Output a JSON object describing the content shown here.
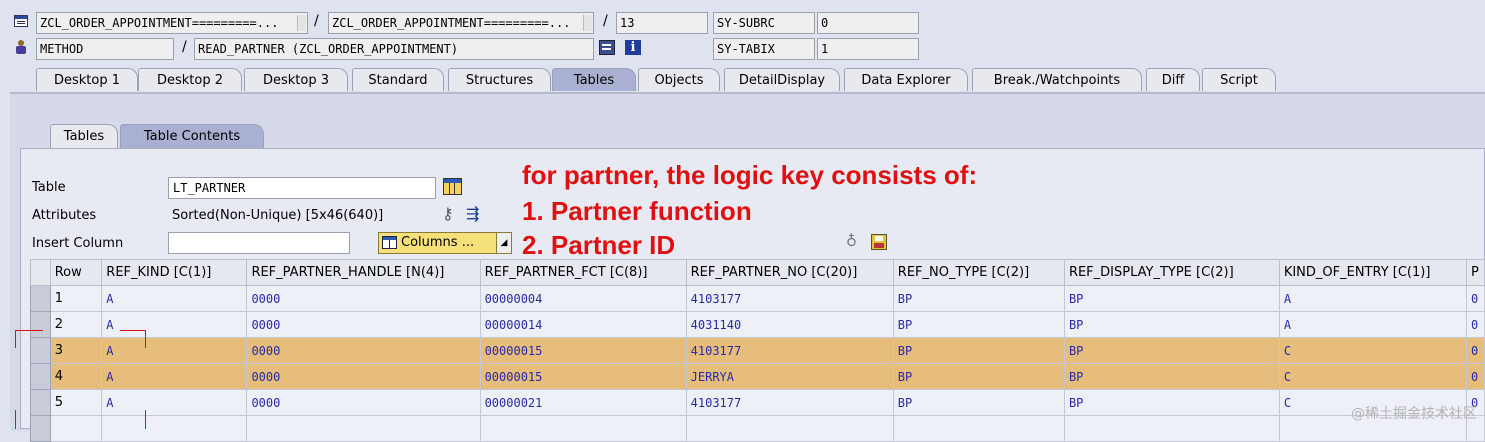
{
  "header": {
    "program1": "ZCL_ORDER_APPOINTMENT=========...",
    "program2": "ZCL_ORDER_APPOINTMENT=========...",
    "line": "13",
    "sy_subrc_label": "SY-SUBRC",
    "sy_subrc_value": "0",
    "event_type": "METHOD",
    "event_name": "READ_PARTNER (ZCL_ORDER_APPOINTMENT)",
    "sy_tabix_label": "SY-TABIX",
    "sy_tabix_value": "1",
    "slash": "/"
  },
  "tabs": [
    "Desktop 1",
    "Desktop 2",
    "Desktop 3",
    "Standard",
    "Structures",
    "Tables",
    "Objects",
    "DetailDisplay",
    "Data Explorer",
    "Break./Watchpoints",
    "Diff",
    "Script"
  ],
  "active_tab": "Tables",
  "sub_tabs": [
    "Tables",
    "Table Contents"
  ],
  "active_sub_tab": "Table Contents",
  "form": {
    "table_label": "Table",
    "table_value": "LT_PARTNER",
    "attributes_label": "Attributes",
    "attributes_value": "Sorted(Non-Unique) [5x46(640)]",
    "insert_column_label": "Insert Column",
    "insert_column_value": "",
    "columns_button": "Columns ..."
  },
  "annotation": {
    "line1": "for partner, the logic key consists of:",
    "line2": "1. Partner function",
    "line3": "2. Partner ID"
  },
  "grid": {
    "columns": [
      "Row",
      "REF_KIND [C(1)]",
      "REF_PARTNER_HANDLE [N(4)]",
      "REF_PARTNER_FCT [C(8)]",
      "REF_PARTNER_NO [C(20)]",
      "REF_NO_TYPE [C(2)]",
      "REF_DISPLAY_TYPE [C(2)]",
      "KIND_OF_ENTRY [C(1)]",
      "P"
    ],
    "rows": [
      {
        "row": "1",
        "kind": "A",
        "handle": "0000",
        "fct": "00000004",
        "no": "4103177",
        "no_type": "BP",
        "display_type": "BP",
        "entry": "A",
        "p": "0"
      },
      {
        "row": "2",
        "kind": "A",
        "handle": "0000",
        "fct": "00000014",
        "no": "4031140",
        "no_type": "BP",
        "display_type": "BP",
        "entry": "A",
        "p": "0"
      },
      {
        "row": "3",
        "kind": "A",
        "handle": "0000",
        "fct": "00000015",
        "no": "4103177",
        "no_type": "BP",
        "display_type": "BP",
        "entry": "C",
        "p": "0"
      },
      {
        "row": "4",
        "kind": "A",
        "handle": "0000",
        "fct": "00000015",
        "no": "JERRYA",
        "no_type": "BP",
        "display_type": "BP",
        "entry": "C",
        "p": "0"
      },
      {
        "row": "5",
        "kind": "A",
        "handle": "0000",
        "fct": "00000021",
        "no": "4103177",
        "no_type": "BP",
        "display_type": "BP",
        "entry": "C",
        "p": "0"
      }
    ],
    "highlighted_rows": [
      "3",
      "4"
    ]
  },
  "watermark": "@稀土掘金技术社区",
  "colors": {
    "annotation": "#e01010",
    "highlight": "#e6bd7a",
    "active_tab": "#a9b0d1"
  }
}
